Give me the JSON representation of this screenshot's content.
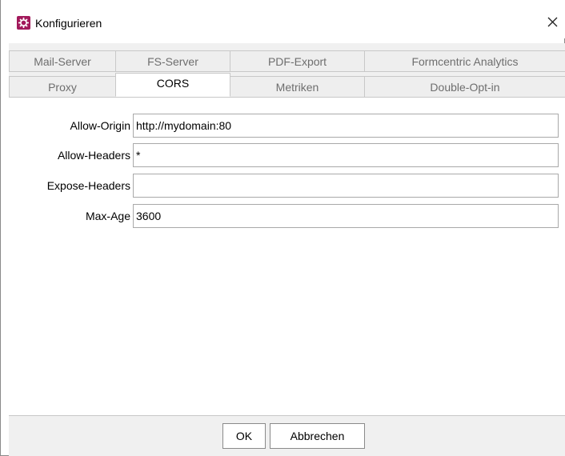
{
  "window": {
    "title": "Konfigurieren",
    "icon": "gear-icon",
    "close_icon": "close-icon"
  },
  "tabs": {
    "row1": [
      {
        "label": "Mail-Server"
      },
      {
        "label": "FS-Server"
      },
      {
        "label": "PDF-Export"
      },
      {
        "label": "Formcentric Analytics"
      }
    ],
    "row2": [
      {
        "label": "Proxy"
      },
      {
        "label": "CORS",
        "active": true
      },
      {
        "label": "Metriken"
      },
      {
        "label": "Double-Opt-in"
      }
    ]
  },
  "form": {
    "fields": [
      {
        "label": "Allow-Origin",
        "value": "http://mydomain:80"
      },
      {
        "label": "Allow-Headers",
        "value": "*"
      },
      {
        "label": "Expose-Headers",
        "value": ""
      },
      {
        "label": "Max-Age",
        "value": "3600"
      }
    ]
  },
  "buttons": {
    "ok": "OK",
    "cancel": "Abbrechen"
  },
  "colors": {
    "icon_bg": "#a2195b",
    "border": "#c8c8c8",
    "inactive_tab_text": "#6e6e6e"
  }
}
